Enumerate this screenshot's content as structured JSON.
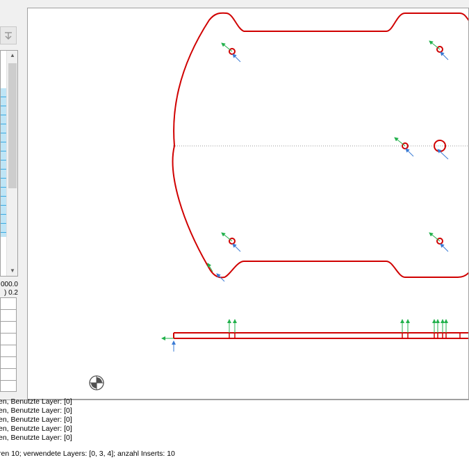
{
  "side_panel": {
    "value_top": "000.0",
    "value_bottom": ") 0.2"
  },
  "log": {
    "lines": [
      "en, Benutzte Layer: [0]",
      "en, Benutzte Layer: [0]",
      "en, Benutzte Layer: [0]",
      "en, Benutzte Layer: [0]",
      "en, Benutzte Layer: [0]",
      "ren 10; verwendete Layers: [0, 3, 4]; anzahl Inserts: 10"
    ]
  },
  "colors": {
    "outline": "#d00000",
    "arrow_green": "#22b14c",
    "arrow_blue": "#3a7bd5",
    "list_highlight": "#bfe5f6",
    "list_grid": "#3ba9e0"
  },
  "icons": [
    "download-icon",
    "scroll-up-icon",
    "scroll-down-icon",
    "origin-marker-icon"
  ]
}
